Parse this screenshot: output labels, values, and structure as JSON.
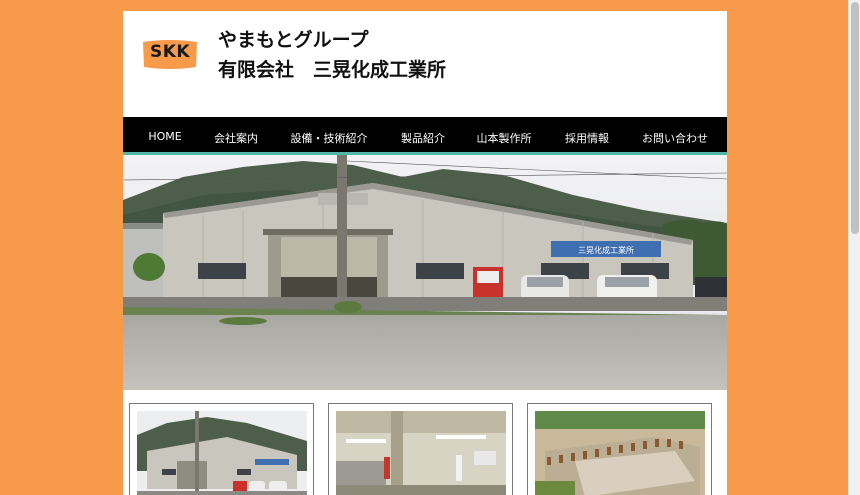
{
  "logo": {
    "text": "SKK"
  },
  "company": {
    "group_name": "やまもとグループ",
    "full_name": "有限会社　三晃化成工業所"
  },
  "nav": {
    "items": [
      {
        "label": "HOME"
      },
      {
        "label": "会社案内"
      },
      {
        "label": "設備・技術紹介"
      },
      {
        "label": "製品紹介"
      },
      {
        "label": "山本製作所"
      },
      {
        "label": "採用情報"
      },
      {
        "label": "お問い合わせ"
      }
    ]
  },
  "hero": {
    "sign_text": "三晃化成工業所"
  },
  "colors": {
    "background": "#f79a4a",
    "nav_background": "#000000",
    "nav_underline": "#4fb6a8",
    "logo_fill": "#f79a4a"
  }
}
